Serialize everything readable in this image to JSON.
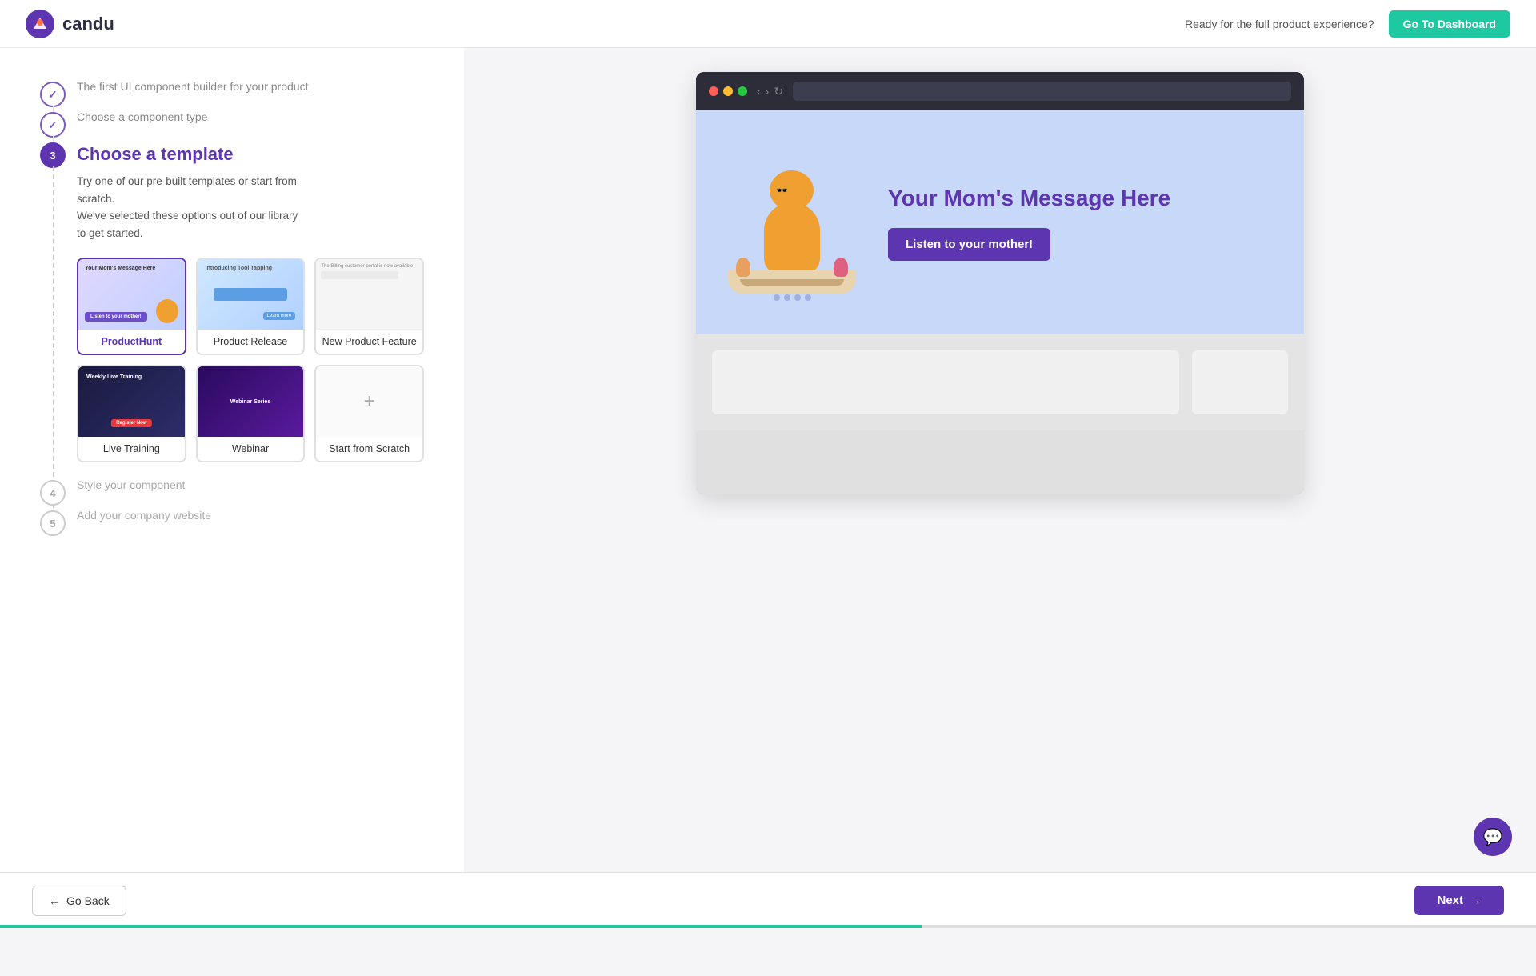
{
  "header": {
    "logo_text": "candu",
    "cta_text": "Ready for the full product experience?",
    "dashboard_btn": "Go To Dashboard"
  },
  "steps": [
    {
      "id": 1,
      "number": "✓",
      "status": "done",
      "label": "The first UI component builder for your product"
    },
    {
      "id": 2,
      "number": "✓",
      "status": "done",
      "label": "Choose a component type"
    },
    {
      "id": 3,
      "number": "3",
      "status": "active",
      "title": "Choose a template",
      "description_line1": "Try one of our pre-built templates or start from",
      "description_line2": "scratch.",
      "description_line3": "We've selected these options out of our library",
      "description_line4": "to get started."
    },
    {
      "id": 4,
      "number": "4",
      "status": "pending",
      "label": "Style your component"
    },
    {
      "id": 5,
      "number": "5",
      "status": "pending",
      "label": "Add your company website"
    }
  ],
  "templates": [
    {
      "id": "producthunt",
      "label": "ProductHunt",
      "selected": true,
      "type": "producthunt"
    },
    {
      "id": "product-release",
      "label": "Product Release",
      "selected": false,
      "type": "release"
    },
    {
      "id": "new-product-feature",
      "label": "New Product Feature",
      "selected": false,
      "type": "feature"
    },
    {
      "id": "live-training",
      "label": "Live Training",
      "selected": false,
      "type": "live"
    },
    {
      "id": "webinar",
      "label": "Webinar",
      "selected": false,
      "type": "webinar"
    },
    {
      "id": "start-from-scratch",
      "label": "Start from Scratch",
      "selected": false,
      "type": "scratch"
    }
  ],
  "preview": {
    "title": "Your Mom's Message Here",
    "cta_button": "Listen to your mother!"
  },
  "footer": {
    "back_btn": "Go Back",
    "next_btn": "Next",
    "progress_pct": 60
  },
  "chat": {
    "icon": "💬"
  }
}
